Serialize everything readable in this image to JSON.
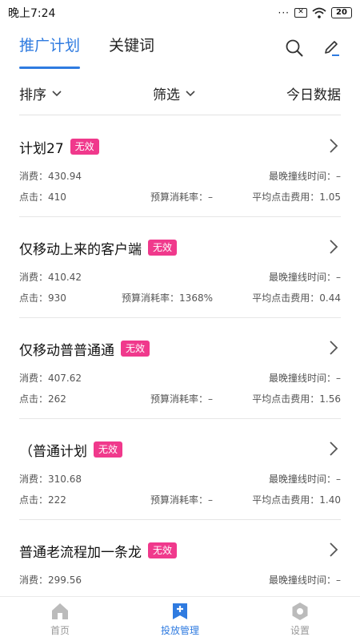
{
  "status_bar": {
    "time": "晚上7:24",
    "dots": "···",
    "sim": "✕",
    "battery": "20"
  },
  "tabs": [
    {
      "label": "推广计划"
    },
    {
      "label": "关键词"
    }
  ],
  "filters": {
    "sort_label": "排序",
    "filter_label": "筛选",
    "today_label": "今日数据"
  },
  "plans": [
    {
      "name": "计划27",
      "status": "无效",
      "spend_label": "消费",
      "spend": "430.94",
      "latest_label": "最晚撞线时间",
      "latest": "–",
      "clicks_label": "点击",
      "clicks": "410",
      "budget_label": "预算消耗率",
      "budget": "–",
      "cpc_label": "平均点击费用",
      "cpc": "1.05"
    },
    {
      "name": "仅移动上来的客户端",
      "status": "无效",
      "spend_label": "消费",
      "spend": "410.42",
      "latest_label": "最晚撞线时间",
      "latest": "–",
      "clicks_label": "点击",
      "clicks": "930",
      "budget_label": "预算消耗率",
      "budget": "1368%",
      "cpc_label": "平均点击费用",
      "cpc": "0.44"
    },
    {
      "name": "仅移动普普通通",
      "status": "无效",
      "spend_label": "消费",
      "spend": "407.62",
      "latest_label": "最晚撞线时间",
      "latest": "–",
      "clicks_label": "点击",
      "clicks": "262",
      "budget_label": "预算消耗率",
      "budget": "–",
      "cpc_label": "平均点击费用",
      "cpc": "1.56"
    },
    {
      "name": "（普通计划",
      "status": "无效",
      "spend_label": "消费",
      "spend": "310.68",
      "latest_label": "最晚撞线时间",
      "latest": "–",
      "clicks_label": "点击",
      "clicks": "222",
      "budget_label": "预算消耗率",
      "budget": "–",
      "cpc_label": "平均点击费用",
      "cpc": "1.40"
    },
    {
      "name": "普通老流程加一条龙",
      "status": "无效",
      "spend_label": "消费",
      "spend": "299.56",
      "latest_label": "最晚撞线时间",
      "latest": "–"
    }
  ],
  "bottom_nav": [
    {
      "label": "首页",
      "icon": "home-icon"
    },
    {
      "label": "投放管理",
      "icon": "plus-square-icon"
    },
    {
      "label": "设置",
      "icon": "settings-icon"
    }
  ],
  "colors": {
    "accent": "#2f7be0",
    "badge": "#f0398c"
  }
}
